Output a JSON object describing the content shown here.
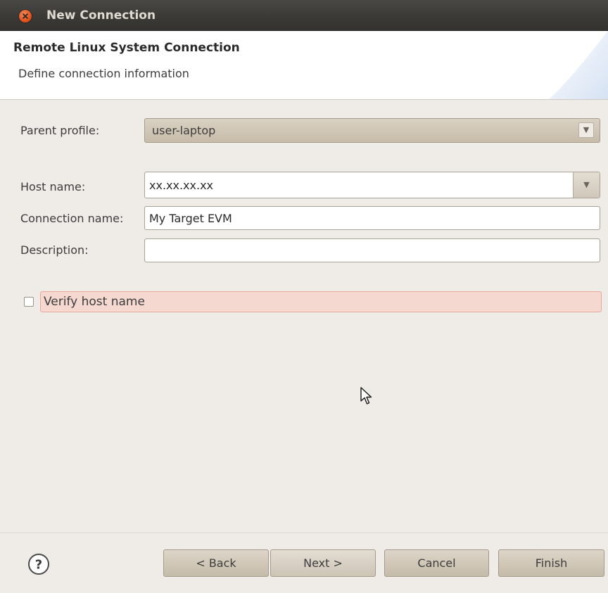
{
  "window": {
    "title": "New Connection"
  },
  "banner": {
    "title": "Remote Linux System Connection",
    "subtitle": "Define connection information"
  },
  "form": {
    "parent_profile": {
      "label": "Parent profile:",
      "value": "user-laptop"
    },
    "host_name": {
      "label": "Host name:",
      "value": "xx.xx.xx.xx"
    },
    "connection_name": {
      "label": "Connection name:",
      "value": "My Target EVM"
    },
    "description": {
      "label": "Description:",
      "value": ""
    },
    "verify_host": {
      "label": "Verify host name",
      "checked": false
    }
  },
  "buttons": {
    "back": "< Back",
    "next": "Next >",
    "cancel": "Cancel",
    "finish": "Finish"
  },
  "icons": {
    "close": "close-icon",
    "help": "help-icon",
    "dropdown": "chevron-down-icon",
    "cursor": "mouse-pointer-icon"
  },
  "colors": {
    "titlebar": "#3c3b37",
    "close_button": "#e0541f",
    "window_background": "#efebe7",
    "verify_highlight": "#f5d9d1",
    "button_face": "#d2c9ba"
  }
}
